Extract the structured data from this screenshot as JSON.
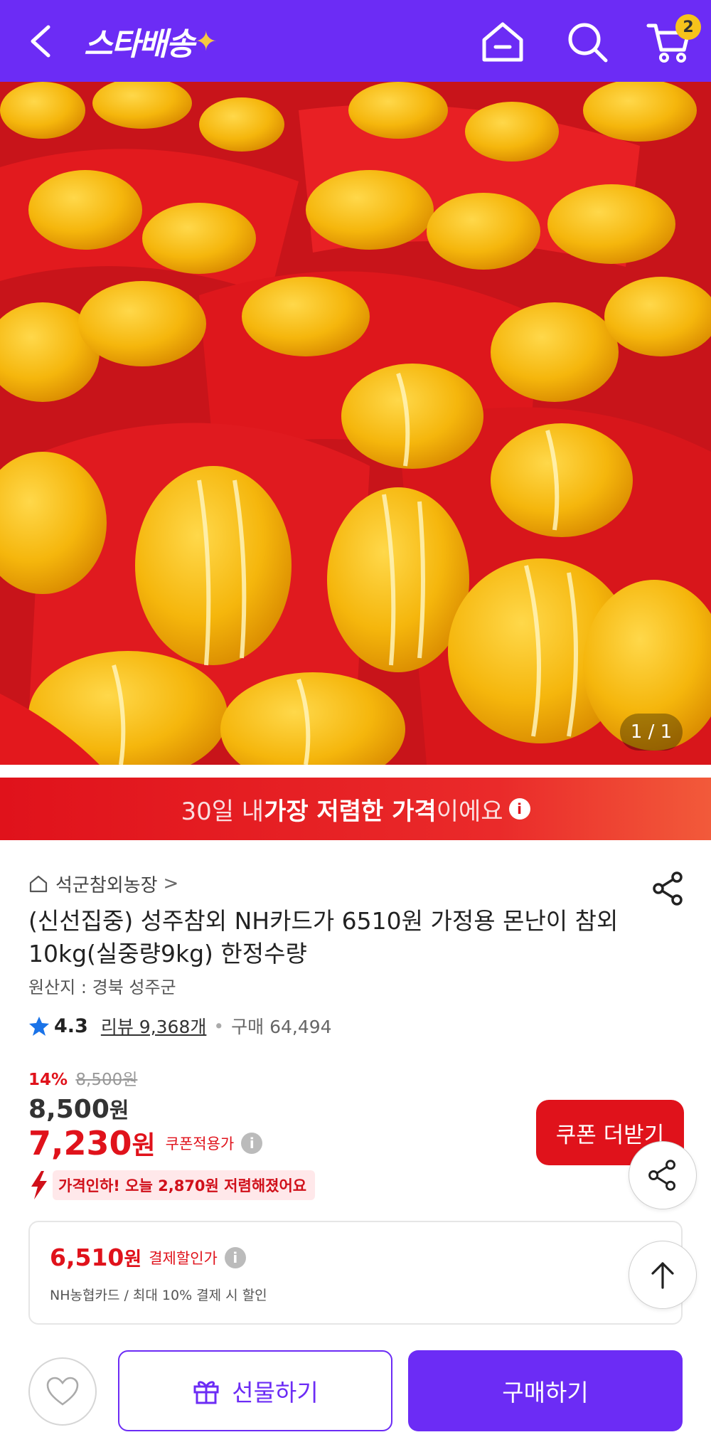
{
  "header": {
    "logo_text": "스타배송",
    "logo_spark": "✦",
    "cart_count": "2",
    "bg_color": "#6c2cf5"
  },
  "gallery": {
    "counter": "1 / 1"
  },
  "banner": {
    "text_prefix": "30일 내 ",
    "text_strong": "가장 저렴한 가격",
    "text_suffix": "이에요",
    "info_glyph": "i"
  },
  "product": {
    "store_name": "석군참외농장",
    "store_chevron": ">",
    "title": "(신선집중) 성주참외  NH카드가 6510원 가정용 몬난이 참외10kg(실중량9kg) 한정수량",
    "origin": "원산지 : 경북 성주군",
    "rating": "4.3",
    "review_label": "리뷰 9,368개",
    "separator": "•",
    "purchase_label": "구매 64,494"
  },
  "pricing": {
    "discount_pct": "14%",
    "original_price": "8,500원",
    "sale_price": "8,500",
    "won": "원",
    "coupon_price": "7,230",
    "coupon_label": "쿠폰적용가",
    "price_drop_text": "가격인하! 오늘 2,870원 저렴해졌어요",
    "coupon_button": "쿠폰 더받기",
    "info_glyph": "i"
  },
  "payment": {
    "amount": "6,510",
    "won": "원",
    "label": "결제할인가",
    "detail": "NH농협카드 / 최대 10% 결제 시 할인"
  },
  "bottom_bar": {
    "gift_label": "선물하기",
    "buy_label": "구매하기"
  },
  "colors": {
    "brand_purple": "#6c2cf5",
    "accent_red": "#e0121b",
    "badge_yellow": "#f6c31c"
  },
  "icons": [
    "back-arrow-icon",
    "home-icon",
    "search-icon",
    "cart-icon",
    "store-home-icon",
    "share-icon",
    "star-icon",
    "info-icon",
    "price-drop-icon",
    "scroll-top-icon",
    "heart-icon",
    "gift-icon"
  ]
}
